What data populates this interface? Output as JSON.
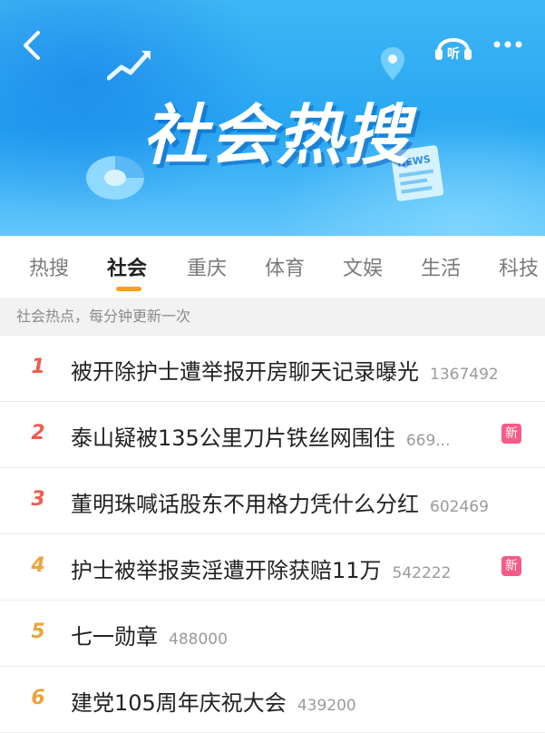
{
  "banner": {
    "title": "社会热搜",
    "listen_label": "听",
    "news_label": "NEWS"
  },
  "tabs": [
    {
      "label": "热搜"
    },
    {
      "label": "社会"
    },
    {
      "label": "重庆"
    },
    {
      "label": "体育"
    },
    {
      "label": "文娱"
    },
    {
      "label": "生活"
    },
    {
      "label": "科技"
    }
  ],
  "active_tab_index": 1,
  "subheader": "社会热点，每分钟更新一次",
  "list": [
    {
      "rank": "1",
      "title": "被开除护士遭举报开房聊天记录曝光",
      "count": "1367492",
      "badge": ""
    },
    {
      "rank": "2",
      "title": "泰山疑被135公里刀片铁丝网围住",
      "count": "669...",
      "badge": "新"
    },
    {
      "rank": "3",
      "title": "董明珠喊话股东不用格力凭什么分红",
      "count": "602469",
      "badge": ""
    },
    {
      "rank": "4",
      "title": "护士被举报卖淫遭开除获赔11万",
      "count": "542222",
      "badge": "新"
    },
    {
      "rank": "5",
      "title": "七一勋章",
      "count": "488000",
      "badge": ""
    },
    {
      "rank": "6",
      "title": "建党105周年庆祝大会",
      "count": "439200",
      "badge": ""
    }
  ],
  "colors": {
    "accent": "#f7a11b",
    "rank_top": "#f25a4e",
    "rank_other": "#f0a23a",
    "badge": "#f45b86",
    "banner": "#27a6f2"
  }
}
